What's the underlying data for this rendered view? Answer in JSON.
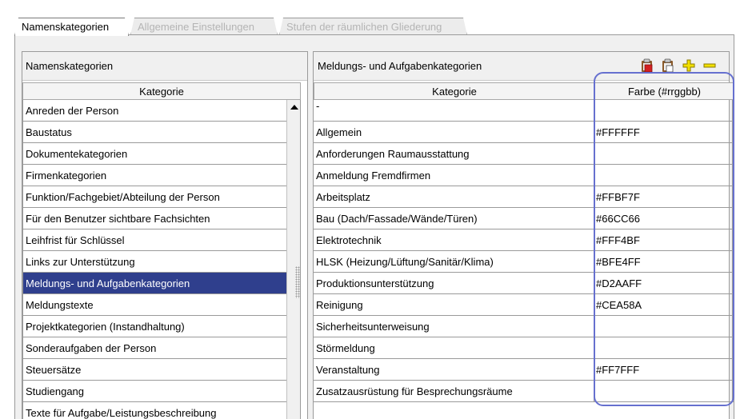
{
  "tabs": [
    {
      "label": "Namenskategorien",
      "active": true
    },
    {
      "label": "Allgemeine Einstellungen",
      "active": false
    },
    {
      "label": "Stufen der räumlichen Gliederung",
      "active": false
    }
  ],
  "left": {
    "title": "Namenskategorien",
    "column": "Kategorie",
    "selected_index": 8,
    "rows": [
      "Anreden der Person",
      "Baustatus",
      "Dokumentekategorien",
      "Firmenkategorien",
      "Funktion/Fachgebiet/Abteilung der Person",
      "Für den Benutzer sichtbare Fachsichten",
      "Leihfrist für Schlüssel",
      "Links zur Unterstützung",
      "Meldungs- und Aufgabenkategorien",
      "Meldungstexte",
      "Projektkategorien (Instandhaltung)",
      "Sonderaufgaben der Person",
      "Steuersätze",
      "Studiengang",
      "Texte für Aufgabe/Leistungsbeschreibung"
    ]
  },
  "right": {
    "title": "Meldungs- und Aufgabenkategorien",
    "toolbar": {
      "icons": [
        "paste-red-icon",
        "paste-icon",
        "add-icon",
        "remove-icon"
      ],
      "add_color": "#e8d400",
      "remove_color": "#d4b400"
    },
    "columns": [
      "Kategorie",
      "Farbe (#rrggbb)"
    ],
    "rows": [
      {
        "kategorie": "-",
        "farbe": ""
      },
      {
        "kategorie": "Allgemein",
        "farbe": "#FFFFFF"
      },
      {
        "kategorie": "Anforderungen Raumausstattung",
        "farbe": ""
      },
      {
        "kategorie": "Anmeldung Fremdfirmen",
        "farbe": ""
      },
      {
        "kategorie": "Arbeitsplatz",
        "farbe": "#FFBF7F"
      },
      {
        "kategorie": "Bau (Dach/Fassade/Wände/Türen)",
        "farbe": "#66CC66"
      },
      {
        "kategorie": "Elektrotechnik",
        "farbe": "#FFF4BF"
      },
      {
        "kategorie": "HLSK (Heizung/Lüftung/Sanitär/Klima)",
        "farbe": "#BFE4FF"
      },
      {
        "kategorie": "Produktionsunterstützung",
        "farbe": "#D2AAFF"
      },
      {
        "kategorie": "Reinigung",
        "farbe": "#CEA58A"
      },
      {
        "kategorie": "Sicherheitsunterweisung",
        "farbe": ""
      },
      {
        "kategorie": "Störmeldung",
        "farbe": ""
      },
      {
        "kategorie": "Veranstaltung",
        "farbe": "#FF7FFF"
      },
      {
        "kategorie": "Zusatzausrüstung für Besprechungsräume",
        "farbe": ""
      }
    ]
  },
  "colors": {
    "selection": "#2f3f8d",
    "highlight_outline": "#6670cf"
  }
}
